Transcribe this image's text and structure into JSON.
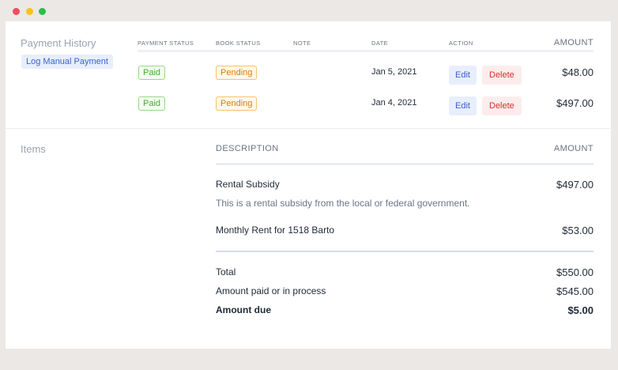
{
  "payment_history": {
    "title": "Payment History",
    "log_button": "Log Manual Payment",
    "columns": {
      "payment_status": "PAYMENT STATUS",
      "book_status": "BOOK STATUS",
      "note": "NOTE",
      "date": "DATE",
      "action": "ACTION",
      "amount": "AMOUNT"
    },
    "rows": [
      {
        "payment_status": "Paid",
        "book_status": "Pending",
        "note": "",
        "date": "Jan 5, 2021",
        "edit": "Edit",
        "delete": "Delete",
        "amount": "$48.00"
      },
      {
        "payment_status": "Paid",
        "book_status": "Pending",
        "note": "",
        "date": "Jan 4, 2021",
        "edit": "Edit",
        "delete": "Delete",
        "amount": "$497.00"
      }
    ]
  },
  "items": {
    "title": "Items",
    "columns": {
      "description": "DESCRIPTION",
      "amount": "AMOUNT"
    },
    "rows": [
      {
        "description": "Rental Subsidy",
        "sub": "This is a rental subsidy from the local or federal government.",
        "amount": "$497.00"
      },
      {
        "description": "Monthly Rent for 1518 Barto",
        "amount": "$53.00"
      }
    ],
    "totals": [
      {
        "label": "Total",
        "amount": "$550.00"
      },
      {
        "label": "Amount paid or in process",
        "amount": "$545.00"
      },
      {
        "label": "Amount due",
        "amount": "$5.00"
      }
    ]
  },
  "colors": {
    "paid": "#3fae2a",
    "pending": "#d47f0a",
    "edit": "#3b5fc4",
    "delete": "#d0342c",
    "window_close": "#ee4d5e",
    "window_minimize": "#f5c518",
    "window_maximize": "#2ebd4a"
  }
}
